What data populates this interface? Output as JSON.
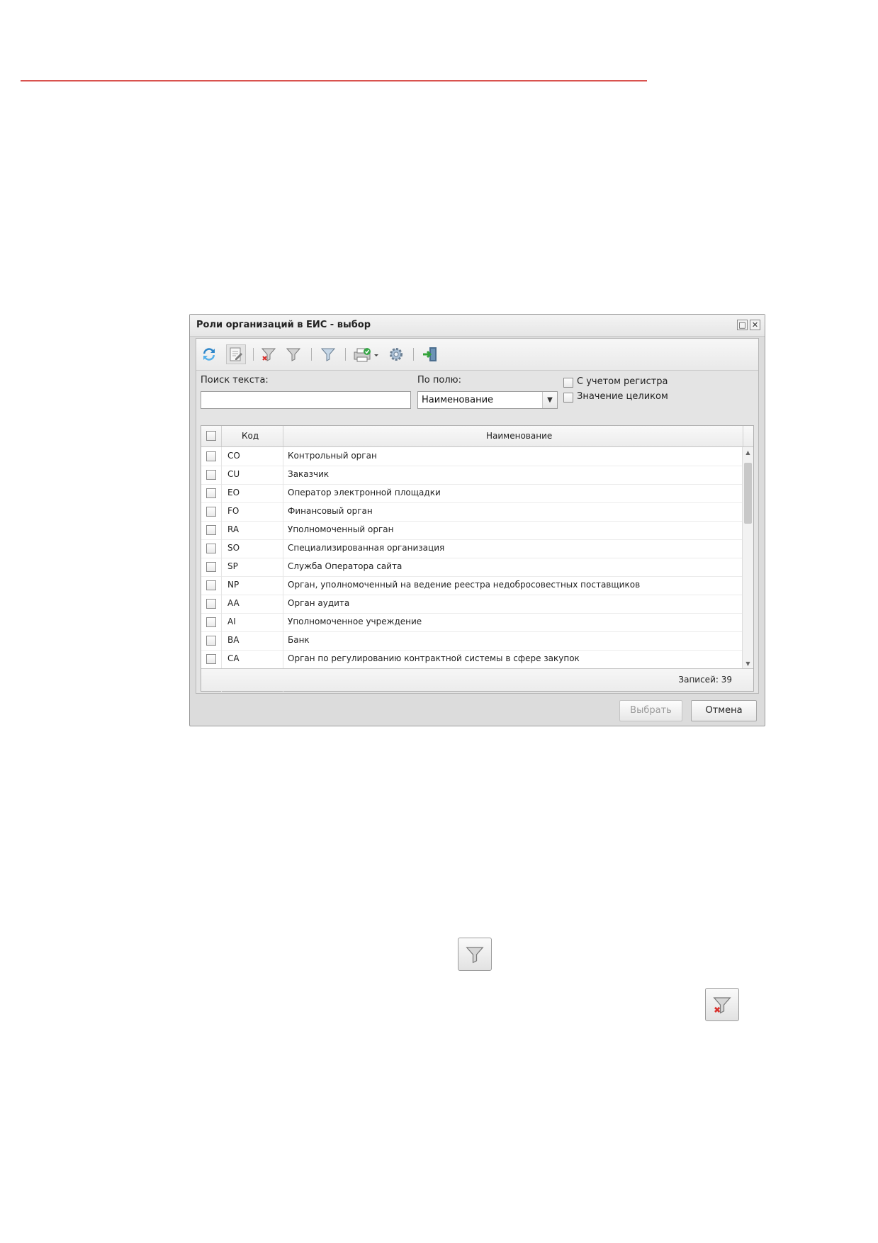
{
  "dialog": {
    "title": "Роли организаций в ЕИС - выбор",
    "window_buttons": {
      "maximize": "□",
      "close": "✕"
    }
  },
  "toolbar": {
    "icons": [
      "refresh-icon",
      "edit-icon",
      "clear-filter-icon",
      "filter-icon",
      "apply-filter-icon",
      "print-icon",
      "settings-icon",
      "exit-icon"
    ]
  },
  "search": {
    "search_label": "Поиск текста:",
    "search_value": "",
    "field_label": "По полю:",
    "field_value": "Наименование",
    "case_label": "С учетом регистра",
    "whole_label": "Значение целиком"
  },
  "grid": {
    "headers": {
      "code": "Код",
      "name": "Наименование"
    },
    "rows": [
      {
        "code": "CO",
        "name": "Контрольный орган"
      },
      {
        "code": "CU",
        "name": "Заказчик"
      },
      {
        "code": "EO",
        "name": "Оператор электронной площадки"
      },
      {
        "code": "FO",
        "name": "Финансовый орган"
      },
      {
        "code": "RA",
        "name": "Уполномоченный орган"
      },
      {
        "code": "SO",
        "name": "Специализированная организация"
      },
      {
        "code": "SP",
        "name": "Служба Оператора сайта"
      },
      {
        "code": "NP",
        "name": "Орган, уполномоченный на ведение реестра недобросовестных поставщиков"
      },
      {
        "code": "AA",
        "name": "Орган аудита"
      },
      {
        "code": "AI",
        "name": "Уполномоченное учреждение"
      },
      {
        "code": "BA",
        "name": "Банк"
      },
      {
        "code": "CA",
        "name": "Орган по регулированию контрактной системы в сфере закупок"
      }
    ],
    "records": "Записей: 39"
  },
  "buttons": {
    "select": "Выбрать",
    "cancel": "Отмена"
  },
  "colors": {
    "accent_red": "#d9534f",
    "window_bg": "#dcdcdc"
  }
}
